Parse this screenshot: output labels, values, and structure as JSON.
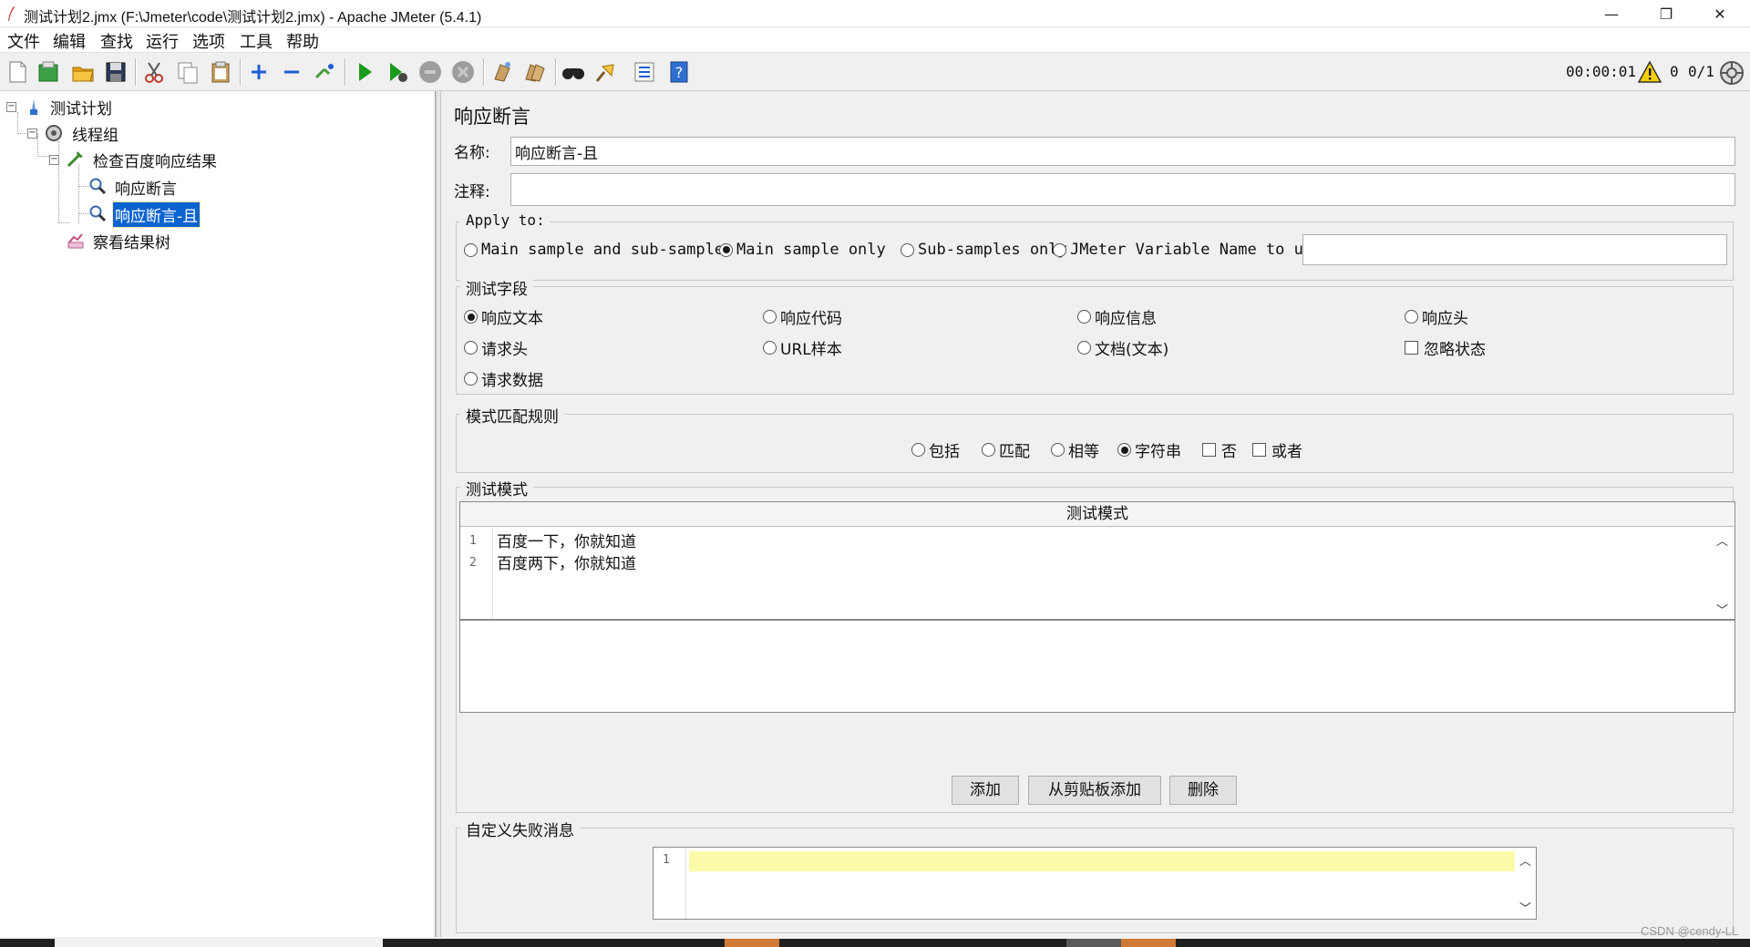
{
  "window": {
    "title": "测试计划2.jmx (F:\\Jmeter\\code\\测试计划2.jmx) - Apache JMeter (5.4.1)",
    "minimize": "—",
    "maximize": "❐",
    "close": "✕"
  },
  "menu": [
    "文件",
    "编辑",
    "查找",
    "运行",
    "选项",
    "工具",
    "帮助"
  ],
  "toolbar": {
    "buttons": [
      "new-icon",
      "templates-icon",
      "open-icon",
      "save-icon",
      "cut-icon",
      "copy-icon",
      "paste-icon",
      "expand-icon",
      "collapse-icon",
      "toggle-icon",
      "start-icon",
      "start-no-pause-icon",
      "stop-icon",
      "shutdown-icon",
      "clear-icon",
      "clear-all-icon",
      "search-icon",
      "reset-search-icon",
      "function-helper-icon",
      "help-icon"
    ],
    "timer": "00:00:01",
    "error_count": "0",
    "threads": "0/1"
  },
  "tree": [
    {
      "label": "测试计划",
      "icon": "test-plan-icon"
    },
    {
      "label": "线程组",
      "icon": "thread-group-icon"
    },
    {
      "label": "检查百度响应结果",
      "icon": "sampler-icon"
    },
    {
      "label": "响应断言",
      "icon": "assertion-icon"
    },
    {
      "label": "响应断言-且",
      "icon": "assertion-icon"
    },
    {
      "label": "察看结果树",
      "icon": "listener-icon"
    }
  ],
  "panel": {
    "title": "响应断言",
    "name_label": "名称:",
    "name_value": "响应断言-且",
    "comment_label": "注释:",
    "comment_value": "",
    "apply_to": {
      "title": "Apply to:",
      "options": [
        "Main sample and sub-samples",
        "Main sample only",
        "Sub-samples only",
        "JMeter Variable Name to use"
      ],
      "selected": "Main sample only",
      "variable_value": ""
    },
    "test_field": {
      "title": "测试字段",
      "options": [
        "响应文本",
        "响应代码",
        "响应信息",
        "响应头",
        "请求头",
        "URL样本",
        "文档(文本)",
        "请求数据"
      ],
      "selected": "响应文本",
      "ignore_status": "忽略状态"
    },
    "match_rules": {
      "title": "模式匹配规则",
      "options": [
        "包括",
        "匹配",
        "相等",
        "字符串"
      ],
      "selected": "字符串",
      "not_label": "否",
      "or_label": "或者"
    },
    "patterns": {
      "title": "测试模式",
      "header": "测试模式",
      "line_numbers": [
        "1",
        "2"
      ],
      "lines": [
        "百度一下，你就知道",
        "百度两下，你就知道"
      ]
    },
    "buttons": {
      "add": "添加",
      "add_clipboard": "从剪贴板添加",
      "delete": "删除"
    },
    "failure": {
      "title": "自定义失败消息",
      "line_number": "1",
      "value": ""
    }
  },
  "watermark": "CSDN @cendy-LL",
  "colors": {
    "selection": "#0b63d0",
    "highlight_line": "#fbfaa9",
    "run_green": "#1a9b1a"
  }
}
